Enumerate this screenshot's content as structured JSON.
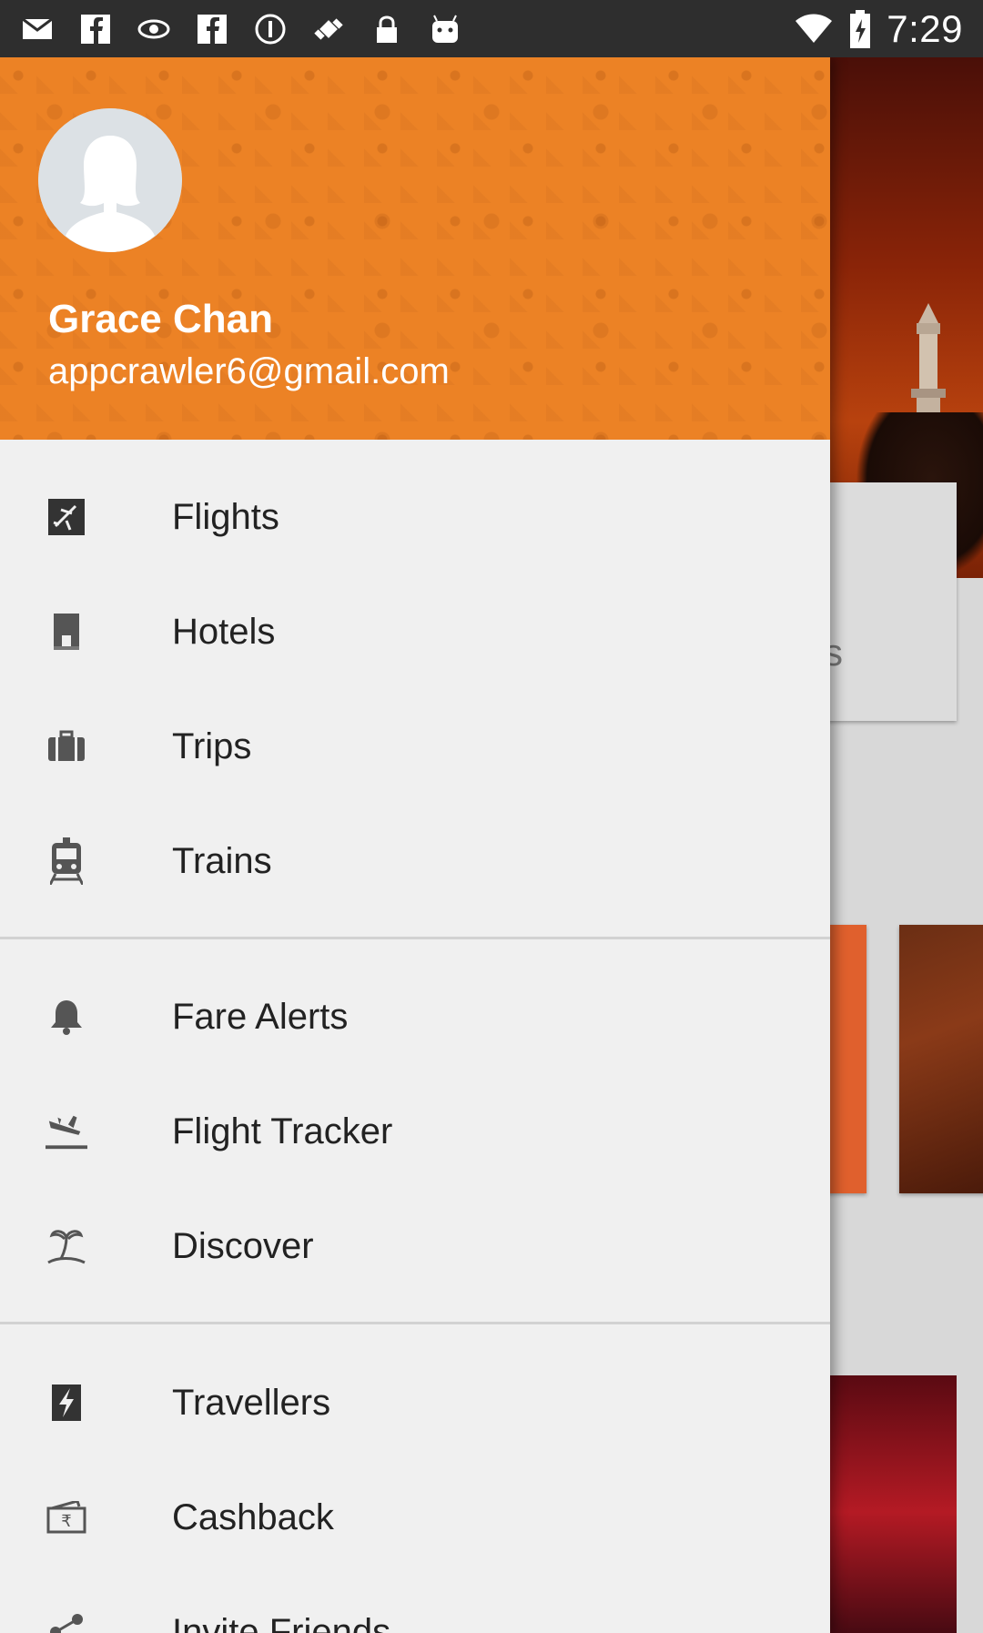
{
  "status_bar": {
    "time": "7:29",
    "left_icons": [
      "mail-icon",
      "facebook-icon",
      "vision-icon",
      "facebook-icon",
      "info-icon",
      "fake-gps-icon",
      "lock-icon",
      "android-icon"
    ],
    "right_icons": [
      "wifi-icon",
      "battery-icon"
    ]
  },
  "drawer": {
    "header": {
      "user_name": "Grace Chan",
      "user_email": "appcrawler6@gmail.com",
      "background_color": "#ec8225"
    },
    "sections": [
      {
        "items": [
          {
            "label": "Flights",
            "icon": "airplane-icon"
          },
          {
            "label": "Hotels",
            "icon": "hotel-icon"
          },
          {
            "label": "Trips",
            "icon": "briefcase-icon"
          },
          {
            "label": "Trains",
            "icon": "train-icon"
          }
        ]
      },
      {
        "items": [
          {
            "label": "Fare Alerts",
            "icon": "bell-icon"
          },
          {
            "label": "Flight Tracker",
            "icon": "flight-land-icon"
          },
          {
            "label": "Discover",
            "icon": "island-icon"
          }
        ]
      },
      {
        "items": [
          {
            "label": "Travellers",
            "icon": "lightning-icon"
          },
          {
            "label": "Cashback",
            "icon": "cash-icon"
          },
          {
            "label": "Invite Friends",
            "icon": "share-icon"
          }
        ]
      }
    ]
  },
  "background_app": {
    "card_text": "s"
  }
}
